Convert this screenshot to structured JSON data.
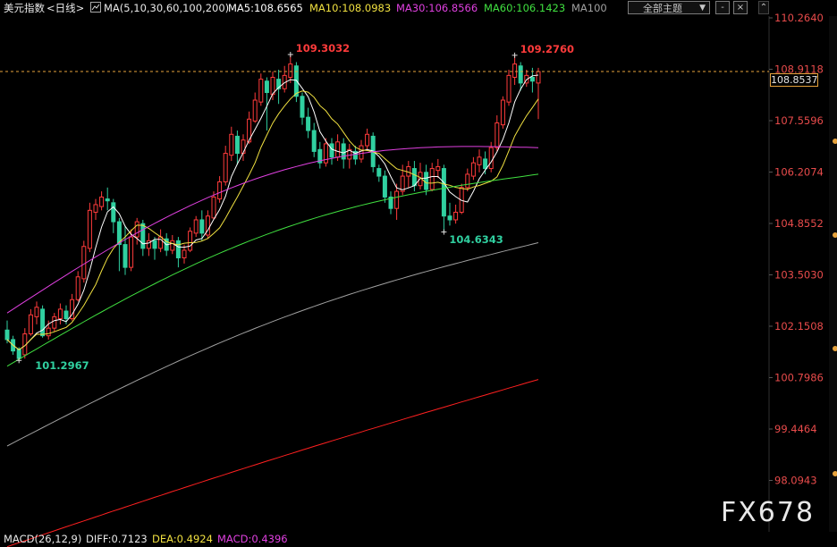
{
  "header": {
    "symbol": "美元指数",
    "period": "<日线>",
    "ma_params": "MA(5,10,30,60,100,200)",
    "ma5": "MA5:108.6565",
    "ma10": "MA10:108.0983",
    "ma30": "MA30:106.8566",
    "ma60": "MA60:106.1423",
    "ma100": "MA100",
    "theme_label": "全部主题",
    "theme_arrow": "▼",
    "btn_minimize": "-",
    "btn_close": "×"
  },
  "colors": {
    "up": "#ff3b3b",
    "down": "#30d0a0",
    "ma5": "#ffffff",
    "ma10": "#f0e040",
    "ma30": "#e040e0",
    "ma60": "#40e040",
    "ma100": "#a0a0a0",
    "ma200": "#ff2020",
    "axis_label": "#e84b4b"
  },
  "price_axis": {
    "ticks": [
      "110.2640",
      "108.9118",
      "107.5596",
      "106.2074",
      "104.8552",
      "103.5030",
      "102.1508",
      "100.7986",
      "99.4464",
      "98.0943"
    ],
    "current_price": "108.8537"
  },
  "annotations": {
    "high1": "109.3032",
    "high2": "109.2760",
    "low1": "104.6343",
    "low0": "101.2967"
  },
  "macd": {
    "params": "MACD(26,12,9)",
    "diff": "DIFF:0.7123",
    "dea": "DEA:0.4924",
    "macd": "MACD:0.4396"
  },
  "watermark": "FX678"
}
